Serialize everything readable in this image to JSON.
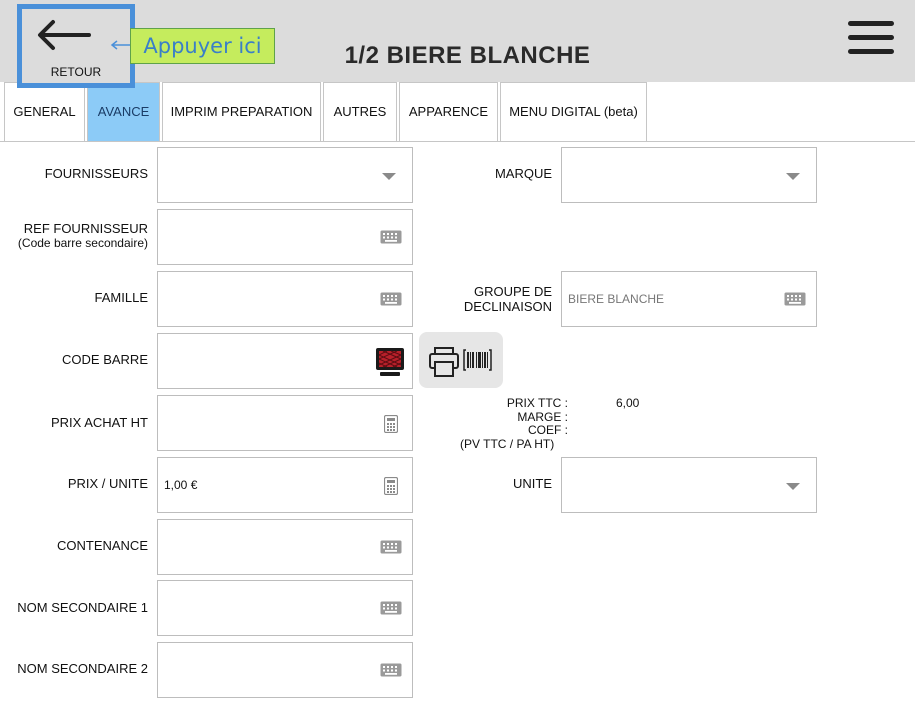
{
  "header": {
    "back_label": "RETOUR",
    "hint": "Appuyer ici",
    "title": "1/2 BIERE BLANCHE",
    "hint_color": "#c5ec5d",
    "highlight_color": "#4a90d9"
  },
  "tabs": [
    {
      "label": "GENERAL",
      "active": false
    },
    {
      "label": "AVANCE",
      "active": true
    },
    {
      "label": "IMPRIM PREPARATION",
      "active": false
    },
    {
      "label": "AUTRES",
      "active": false
    },
    {
      "label": "APPARENCE",
      "active": false
    },
    {
      "label": "MENU DIGITAL (beta)",
      "active": false
    }
  ],
  "accent_color": "#8ccbf7",
  "left_fields": {
    "fournisseurs": {
      "label": "FOURNISSEURS",
      "value": "",
      "icon": "dropdown-arrow-icon"
    },
    "ref_fournisseur": {
      "label": "REF FOURNISSEUR",
      "sublabel": "(Code barre secondaire)",
      "value": "",
      "icon": "keyboard-icon"
    },
    "famille": {
      "label": "FAMILLE",
      "value": "",
      "icon": "keyboard-icon"
    },
    "code_barre": {
      "label": "CODE BARRE",
      "value": "",
      "icon": "barcode-scanner-icon"
    },
    "prix_achat_ht": {
      "label": "PRIX ACHAT HT",
      "value": "",
      "icon": "calculator-icon"
    },
    "prix_unite": {
      "label": "PRIX / UNITE",
      "value": "1,00 €",
      "icon": "calculator-icon"
    },
    "contenance": {
      "label": "CONTENANCE",
      "value": "",
      "icon": "keyboard-icon"
    },
    "nom_secondaire_1": {
      "label": "NOM SECONDAIRE 1",
      "value": "",
      "icon": "keyboard-icon"
    },
    "nom_secondaire_2": {
      "label": "NOM SECONDAIRE 2",
      "value": "",
      "icon": "keyboard-icon"
    }
  },
  "right_fields": {
    "marque": {
      "label": "MARQUE",
      "value": "",
      "icon": "dropdown-arrow-icon"
    },
    "groupe": {
      "label1": "GROUPE DE",
      "label2": "DECLINAISON",
      "value": "BIERE BLANCHE",
      "icon": "keyboard-icon"
    },
    "unite": {
      "label": "UNITE",
      "value": "",
      "icon": "dropdown-arrow-icon"
    }
  },
  "print_barcode_button": {
    "icon": "print-barcode-icon"
  },
  "pricing": {
    "prix_ttc_label": "PRIX TTC :",
    "prix_ttc_value": "6,00",
    "marge_label": "MARGE :",
    "coef_label": "COEF :",
    "coef_note": "(PV TTC / PA HT)"
  }
}
